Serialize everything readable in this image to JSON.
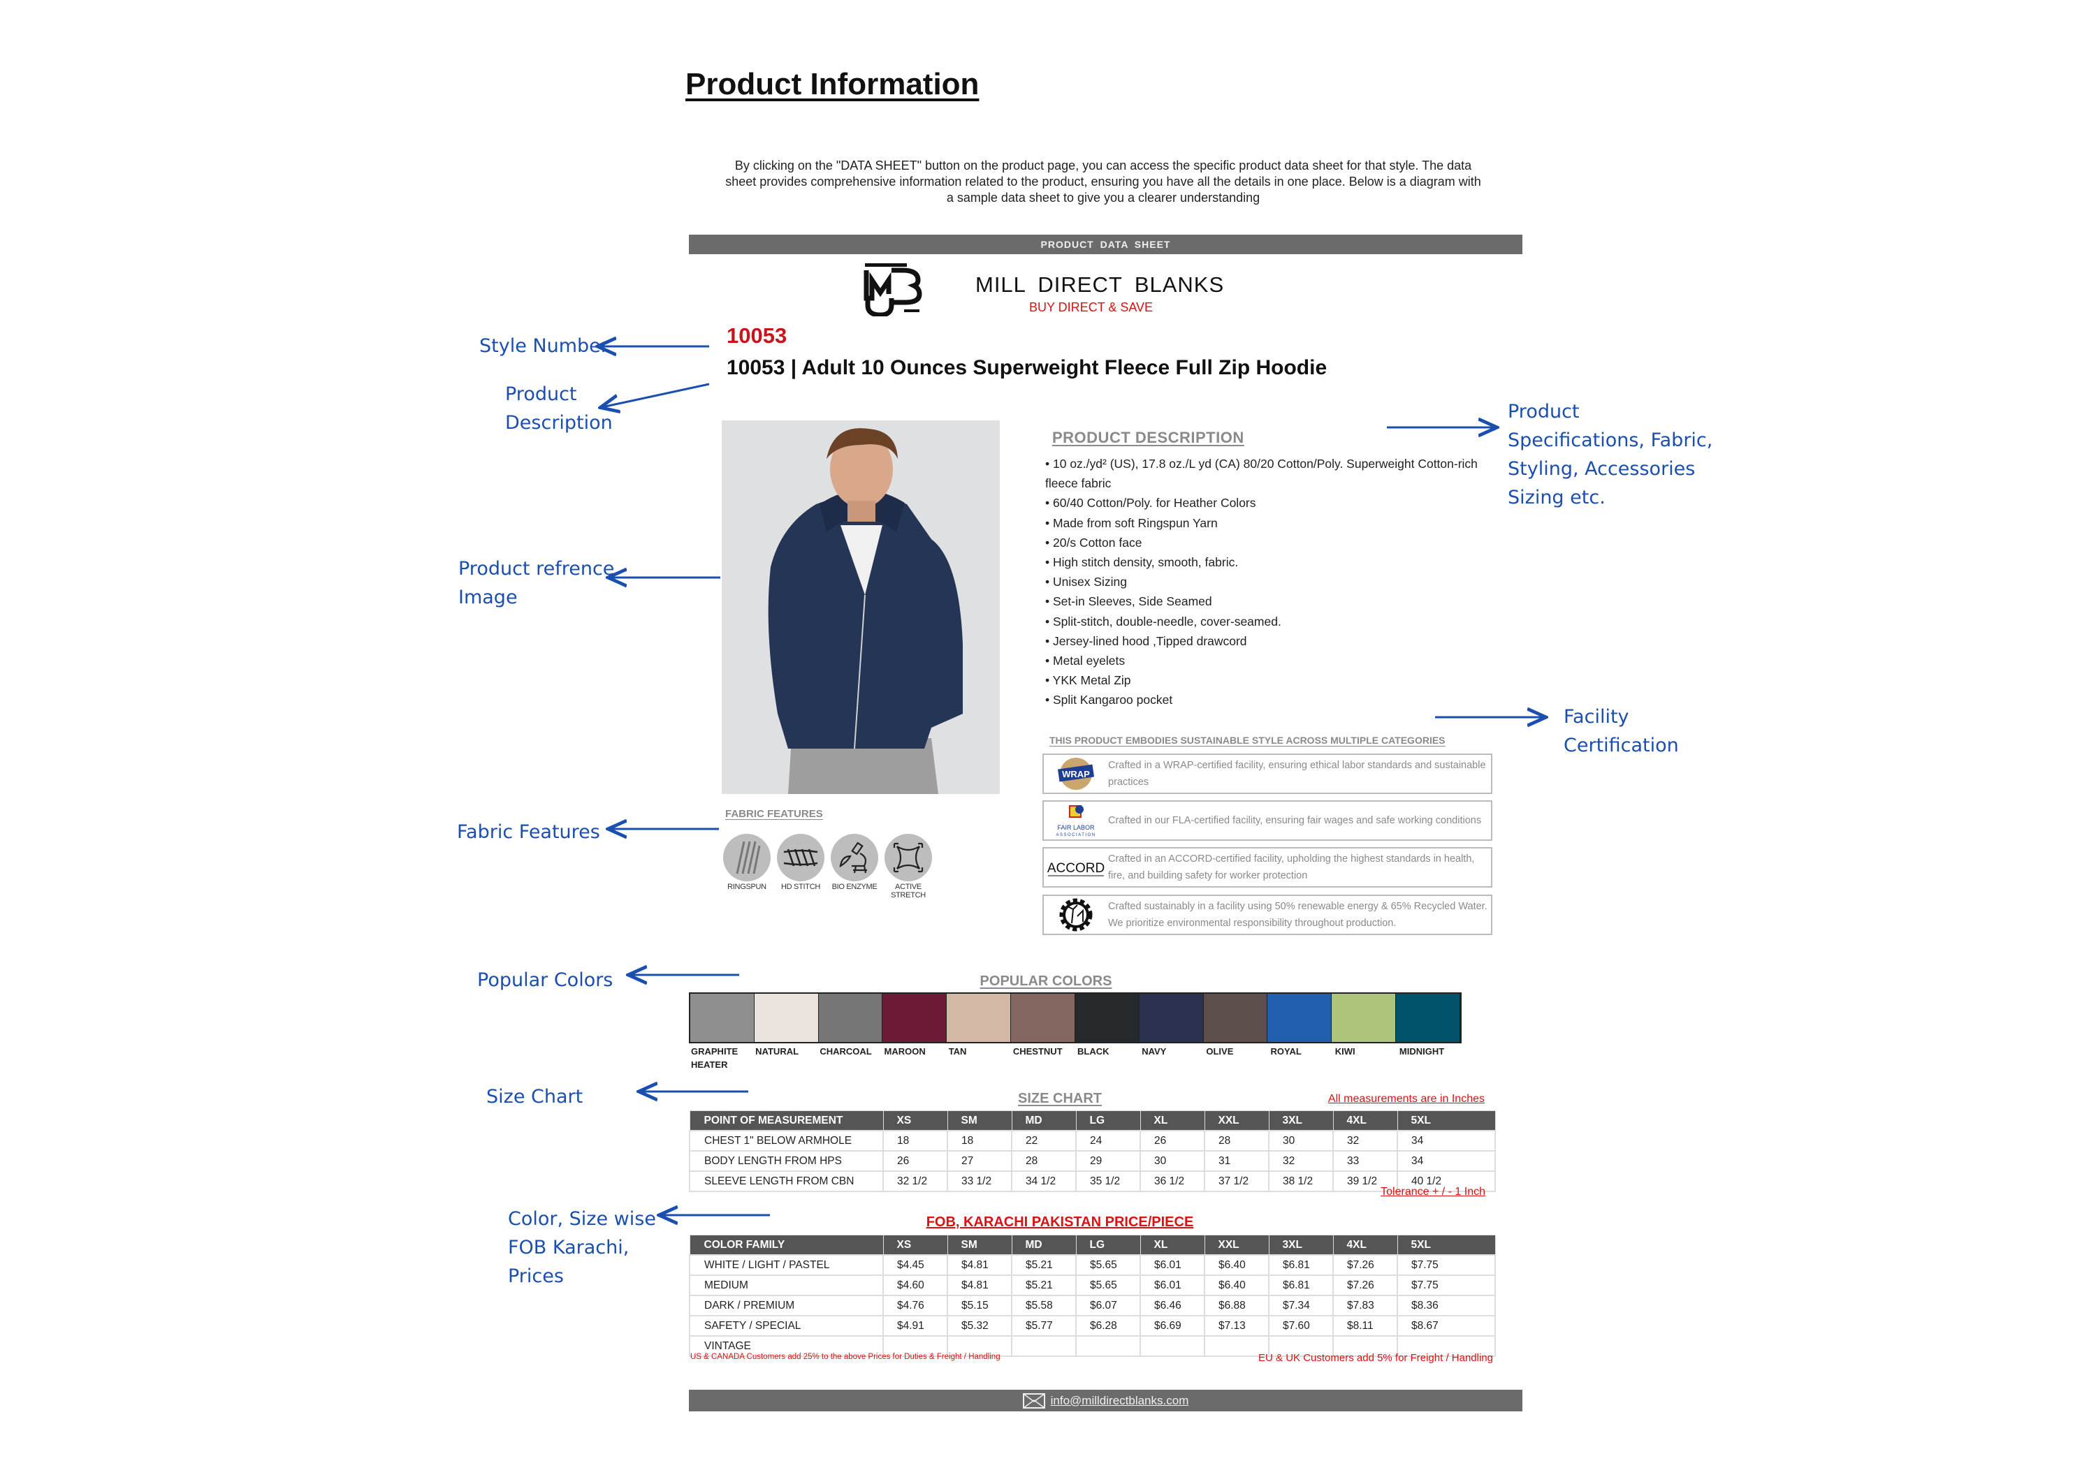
{
  "page_title": "Product Information",
  "intro": "By clicking on the \"DATA SHEET\" button on the product page, you can access the specific product data sheet for that style. The data sheet provides comprehensive information related to the product, ensuring you have all the details in one place. Below is a diagram with a sample data sheet to give you a clearer understanding",
  "sheet": {
    "header_bar": "PRODUCT  DATA  SHEET",
    "brand": {
      "logo_text": "MDB MILL DIRECT BLANKS",
      "name": "MILL  DIRECT  BLANKS",
      "tagline": "BUY DIRECT & SAVE"
    },
    "style_number": "10053",
    "product_title": "10053 | Adult 10 Ounces Superweight Fleece Full Zip Hoodie",
    "description": {
      "heading": "PRODUCT  DESCRIPTION",
      "bullets": [
        "• 10 oz./yd² (US), 17.8 oz./L yd (CA) 80/20 Cotton/Poly. Superweight Cotton-rich fleece fabric",
        "• 60/40 Cotton/Poly. for Heather Colors",
        "• Made from soft Ringspun Yarn",
        "• 20/s Cotton face",
        "• High stitch density, smooth, fabric.",
        "• Unisex Sizing",
        "• Set-in Sleeves, Side Seamed",
        "• Split-stitch, double-needle, cover-seamed.",
        "• Jersey-lined hood ,Tipped drawcord",
        "• Metal eyelets",
        "• YKK Metal Zip",
        "• Split Kangaroo pocket"
      ]
    },
    "sustainability": {
      "heading": "THIS PRODUCT EMBODIES SUSTAINABLE STYLE ACROSS MULTIPLE CATEGORIES",
      "certs": [
        {
          "logo": "WRAP",
          "icon": "wrap-logo-icon",
          "text": "Crafted in a WRAP-certified facility, ensuring ethical labor standards and sustainable practices"
        },
        {
          "logo": "FAIR LABOR ASSOCIATION",
          "icon": "fair-labor-logo-icon",
          "text": "Crafted in our FLA-certified facility, ensuring fair wages and safe working conditions"
        },
        {
          "logo": "ACCORD",
          "icon": "accord-logo-icon",
          "text": "Crafted in an ACCORD-certified facility, upholding the highest standards in health, fire, and building safety for worker protection"
        },
        {
          "logo": "",
          "icon": "renewable-gear-icon",
          "text": "Crafted sustainably in a facility using 50% renewable energy & 65% Recycled Water. We prioritize environmental responsibility throughout production."
        }
      ]
    },
    "fabric_features": {
      "heading": "FABRIC  FEATURES",
      "items": [
        {
          "label": "RINGSPUN",
          "icon": "ringspun-yarn-icon"
        },
        {
          "label": "HD STITCH",
          "icon": "hd-stitch-icon"
        },
        {
          "label": "BIO ENZYME",
          "icon": "microscope-icon"
        },
        {
          "label": "ACTIVE STRETCH",
          "icon": "stretch-arrows-icon"
        }
      ]
    },
    "popular_colors": {
      "heading": "POPULAR  COLORS",
      "colors": [
        {
          "name": "GRAPHITE HEATER",
          "hex": "#8f8f8f"
        },
        {
          "name": "NATURAL",
          "hex": "#ebe3dd"
        },
        {
          "name": "CHARCOAL",
          "hex": "#767676"
        },
        {
          "name": "MAROON",
          "hex": "#6c1a36"
        },
        {
          "name": "TAN",
          "hex": "#d3b9a5"
        },
        {
          "name": "CHESTNUT",
          "hex": "#846761"
        },
        {
          "name": "BLACK",
          "hex": "#25292b"
        },
        {
          "name": "NAVY",
          "hex": "#2b3250"
        },
        {
          "name": "OLIVE",
          "hex": "#5d4f4b"
        },
        {
          "name": "ROYAL",
          "hex": "#215eae"
        },
        {
          "name": "KIWI",
          "hex": "#acc57b"
        },
        {
          "name": "MIDNIGHT",
          "hex": "#00526a"
        }
      ]
    },
    "size_chart": {
      "heading": "SIZE  CHART",
      "units_note": "All measurements are in Inches",
      "tolerance_note": "Tolerance + / - 1 Inch",
      "columns": [
        "POINT OF MEASUREMENT",
        "XS",
        "SM",
        "MD",
        "LG",
        "XL",
        "XXL",
        "3XL",
        "4XL",
        "5XL"
      ],
      "rows": [
        [
          "CHEST 1\" BELOW ARMHOLE",
          "18",
          "18",
          "22",
          "24",
          "26",
          "28",
          "30",
          "32",
          "34"
        ],
        [
          "BODY LENGTH FROM HPS",
          "26",
          "27",
          "28",
          "29",
          "30",
          "31",
          "32",
          "33",
          "34"
        ],
        [
          "SLEEVE LENGTH FROM CBN",
          "32 1/2",
          "33 1/2",
          "34 1/2",
          "35 1/2",
          "36 1/2",
          "37 1/2",
          "38 1/2",
          "39 1/2",
          "40 1/2"
        ]
      ]
    },
    "price_table": {
      "heading": "FOB, KARACHI PAKISTAN PRICE/PIECE",
      "columns": [
        "COLOR FAMILY",
        "XS",
        "SM",
        "MD",
        "LG",
        "XL",
        "XXL",
        "3XL",
        "4XL",
        "5XL"
      ],
      "rows": [
        [
          "WHITE / LIGHT / PASTEL",
          "$4.45",
          "$4.81",
          "$5.21",
          "$5.65",
          "$6.01",
          "$6.40",
          "$6.81",
          "$7.26",
          "$7.75"
        ],
        [
          "MEDIUM",
          "$4.60",
          "$4.81",
          "$5.21",
          "$5.65",
          "$6.01",
          "$6.40",
          "$6.81",
          "$7.26",
          "$7.75"
        ],
        [
          "DARK / PREMIUM",
          "$4.76",
          "$5.15",
          "$5.58",
          "$6.07",
          "$6.46",
          "$6.88",
          "$7.34",
          "$7.83",
          "$8.36"
        ],
        [
          "SAFETY / SPECIAL",
          "$4.91",
          "$5.32",
          "$5.77",
          "$6.28",
          "$6.69",
          "$7.13",
          "$7.60",
          "$8.11",
          "$8.67"
        ],
        [
          "VINTAGE",
          "",
          "",
          "",
          "",
          "",
          "",
          "",
          "",
          ""
        ]
      ],
      "note_left": "US & CANADA Customers add 25% to the above Prices for Duties & Freight / Handling",
      "note_right": "EU & UK Customers add 5% for Freight / Handling"
    },
    "footer_email": "info@milldirectblanks.com"
  },
  "annotations": {
    "style_number": "Style Number",
    "product_description": [
      "Product",
      "Description"
    ],
    "reference_image": [
      "Product refrence",
      "Image"
    ],
    "fabric_features": "Fabric Features",
    "popular_colors": "Popular Colors",
    "size_chart": "Size Chart",
    "prices": [
      "Color, Size wise",
      "FOB Karachi,",
      "Prices"
    ],
    "specifications": [
      "Product",
      "Specifications, Fabric,",
      "Styling, Accessories",
      "Sizing etc."
    ],
    "certification": [
      "Facility",
      "Certification"
    ]
  },
  "colors": {
    "annotation_blue": "#1a4fb0",
    "brand_red": "#c8141c",
    "bar_gray": "#6b6b6b"
  }
}
